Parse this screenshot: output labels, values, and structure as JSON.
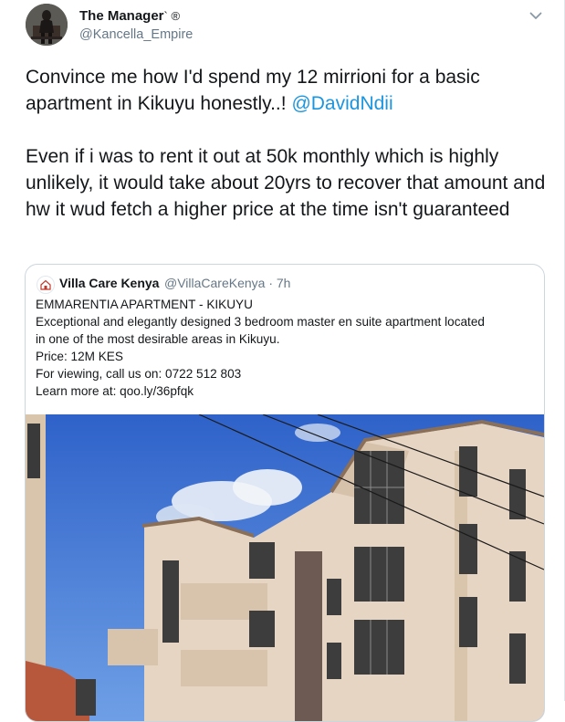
{
  "author": {
    "display_name": "The Manager",
    "symbols": "` ®",
    "handle": "@Kancella_Empire",
    "avatar_icon": "user-avatar"
  },
  "tweet": {
    "line1_text": "Convince me how I'd spend my 12 mirrioni for a basic apartment in Kikuyu honestly..! ",
    "mention": "@DavidNdii",
    "paragraph2": "Even if i was to rent it out at 50k monthly which is highly unlikely, it would take about 20yrs to recover that amount and hw it wud fetch a higher price at the time isn't guaranteed"
  },
  "quoted": {
    "display_name": "Villa Care Kenya",
    "handle_time": "@VillaCareKenya · 7h",
    "lines": [
      "EMMARENTIA APARTMENT - KIKUYU",
      "Exceptional and elegantly designed 3 bedroom master en suite apartment located",
      "in one of the most desirable areas in Kikuyu.",
      "Price: 12M KES",
      "For viewing, call us on: 0722 512 803",
      "Learn more at: qoo.ly/36pfqk"
    ]
  },
  "colors": {
    "link": "#1b95e0",
    "secondary_text": "#657786",
    "border": "#ccd6dd"
  }
}
